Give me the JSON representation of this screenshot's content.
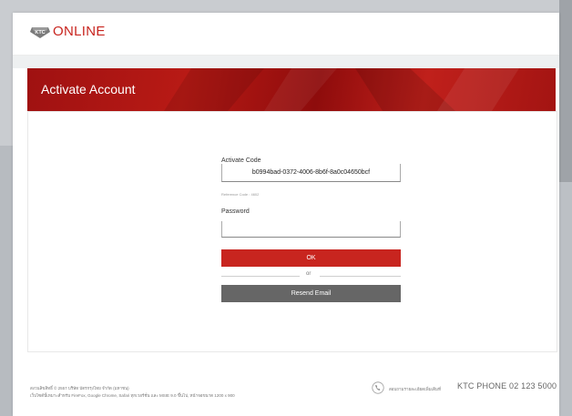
{
  "header": {
    "logo_badge": "KTC",
    "logo_text": "ONLINE",
    "brand_color": "#c8251f"
  },
  "banner": {
    "title": "Activate Account"
  },
  "form": {
    "activate_code_label": "Activate Code",
    "activate_code_value": "b0994bad-0372-4006-8b6f-8a0c04650bcf",
    "reference_code": "Reference Code : 4602",
    "password_label": "Password",
    "password_value": "",
    "ok_label": "OK",
    "or_label": "or",
    "resend_label": "Resend Email"
  },
  "footer": {
    "copyright_line1": "สงวนลิขสิทธิ์ © 2557 บริษัท บัตรกรุงไทย จำกัด (มหาชน)",
    "copyright_line2": "เว็บไซต์นี้เหมาะสำหรับ FireFox, Google Chrome, Safari ทุกเวอร์ชั่น และ MSIE 9.0 ขึ้นไป, หน้าจอขนาด 1200 x 900",
    "phone_caption": "สอบถามรายละเอียดเพิ่มเติมที่",
    "phone_number": "KTC PHONE 02 123 5000"
  }
}
